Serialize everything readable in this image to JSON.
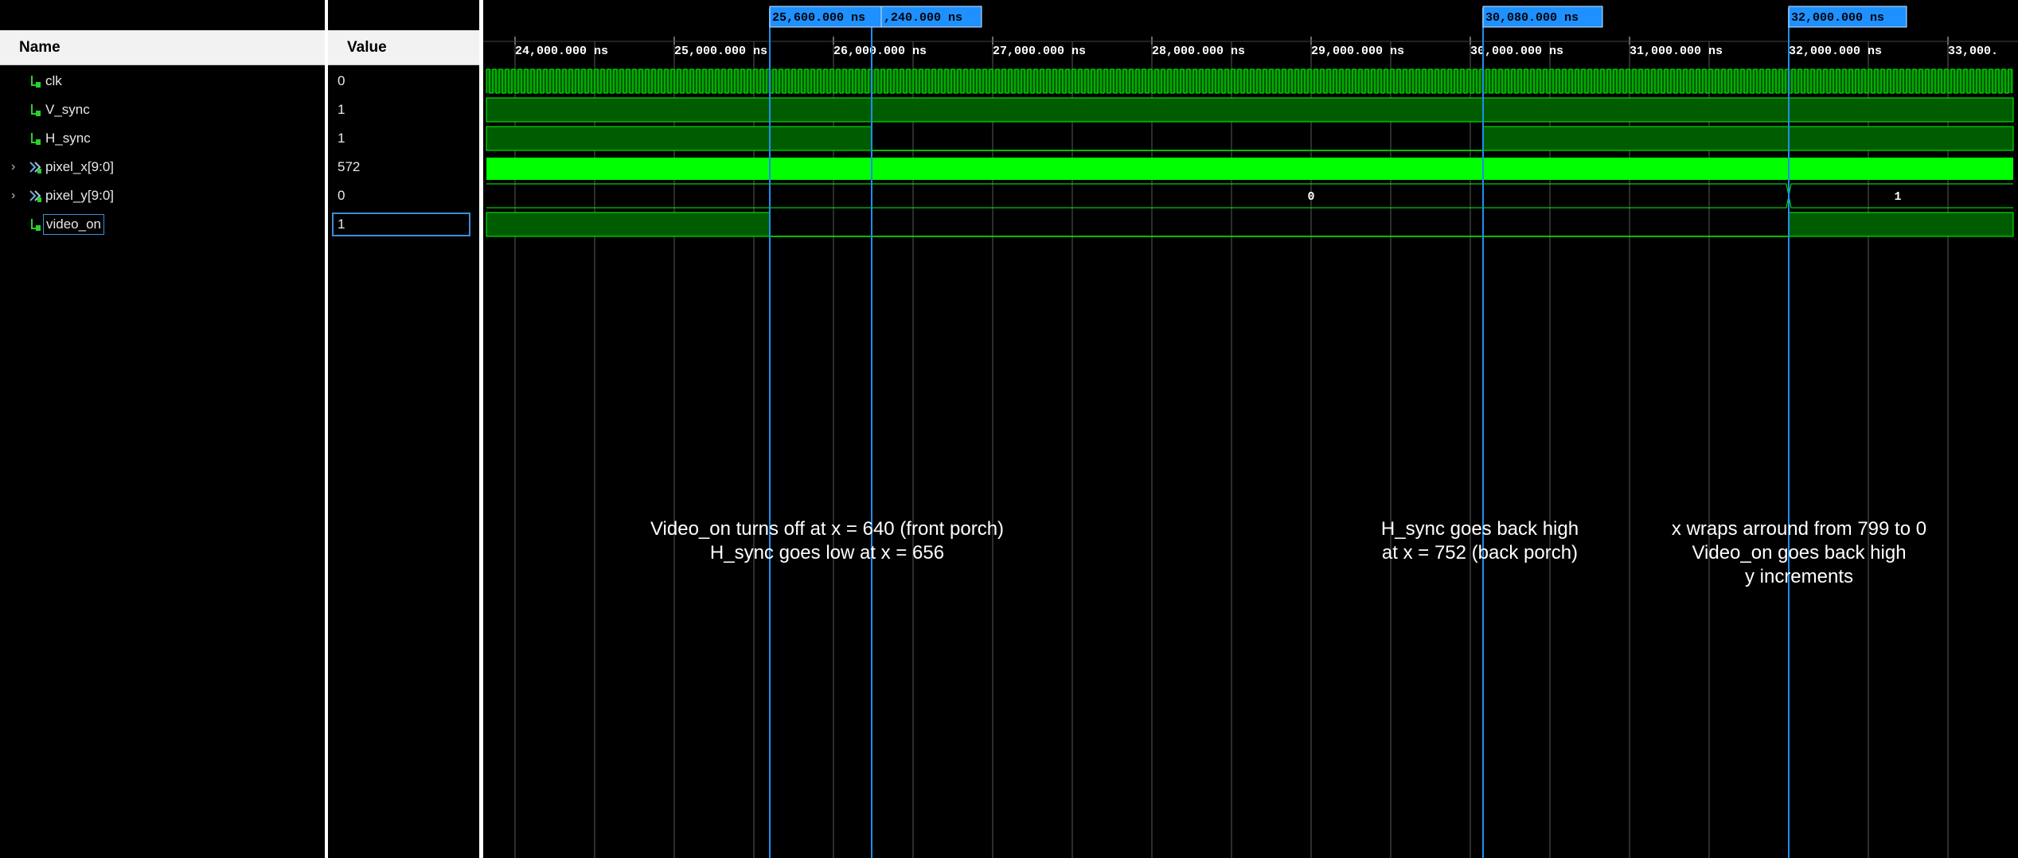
{
  "columns": {
    "name_header": "Name",
    "value_header": "Value"
  },
  "signals": [
    {
      "name": "clk",
      "value": "0",
      "kind": "bit",
      "expandable": false,
      "selected": false
    },
    {
      "name": "V_sync",
      "value": "1",
      "kind": "bit",
      "expandable": false,
      "selected": false
    },
    {
      "name": "H_sync",
      "value": "1",
      "kind": "bit",
      "expandable": false,
      "selected": false
    },
    {
      "name": "pixel_x[9:0]",
      "value": "572",
      "kind": "bus",
      "expandable": true,
      "selected": false
    },
    {
      "name": "pixel_y[9:0]",
      "value": "0",
      "kind": "bus",
      "expandable": true,
      "selected": false
    },
    {
      "name": "video_on",
      "value": "1",
      "kind": "bit",
      "expandable": false,
      "selected": true
    }
  ],
  "timeline": {
    "tick_labels": [
      "24,000.000 ns",
      "25,000.000 ns",
      "26,000.000 ns",
      "27,000.000 ns",
      "28,000.000 ns",
      "29,000.000 ns",
      "30,000.000 ns",
      "31,000.000 ns",
      "32,000.000 ns",
      "33,000."
    ],
    "cursor_labels": [
      "25,600.000 ns",
      ",240.000 ns",
      "30,080.000 ns",
      "32,000.000 ns"
    ]
  },
  "bus_values": {
    "pixel_y_before": "0",
    "pixel_y_after": "1"
  },
  "annotations": [
    {
      "lines": [
        "Video_on turns off at x = 640 (front porch)",
        "H_sync goes low at x = 656"
      ]
    },
    {
      "lines": [
        "H_sync goes back high",
        "at x = 752 (back porch)"
      ]
    },
    {
      "lines": [
        "x wraps arround from 799 to 0",
        "Video_on goes back high",
        "y increments"
      ]
    }
  ],
  "colors": {
    "signal_green": "#00ff00",
    "dark_green": "#005c00",
    "cursor_blue": "#1f8ef1",
    "cursor_label_bg": "#1e90ff",
    "grid_gray": "#5a5a5a"
  },
  "icons": {
    "bit": "bit-signal-icon",
    "bus": "bus-signal-icon",
    "expand": "chevron-right-icon"
  }
}
